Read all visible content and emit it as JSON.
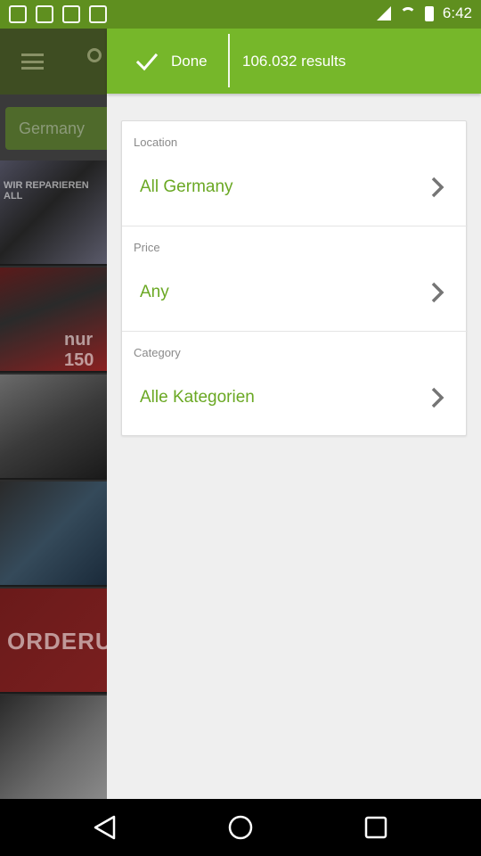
{
  "status_bar": {
    "time": "6:42",
    "icons": [
      "notification-icon",
      "notification-icon",
      "notification-icon",
      "notification-icon",
      "signal-icon",
      "wifi-icon",
      "battery-icon"
    ]
  },
  "background": {
    "chip": "Germany",
    "tile_texts": [
      "WIR REPARIEREN ALL",
      "nur 150",
      "ORDERU"
    ]
  },
  "toolbar": {
    "done_label": "Done",
    "results_label": "106.032 results"
  },
  "filters": {
    "location": {
      "label": "Location",
      "value": "All Germany"
    },
    "price": {
      "label": "Price",
      "value": "Any"
    },
    "category": {
      "label": "Category",
      "value": "Alle Kategorien"
    }
  },
  "colors": {
    "accent": "#76b72a",
    "status_bar": "#5f8f1f",
    "value_text": "#6aa823"
  }
}
